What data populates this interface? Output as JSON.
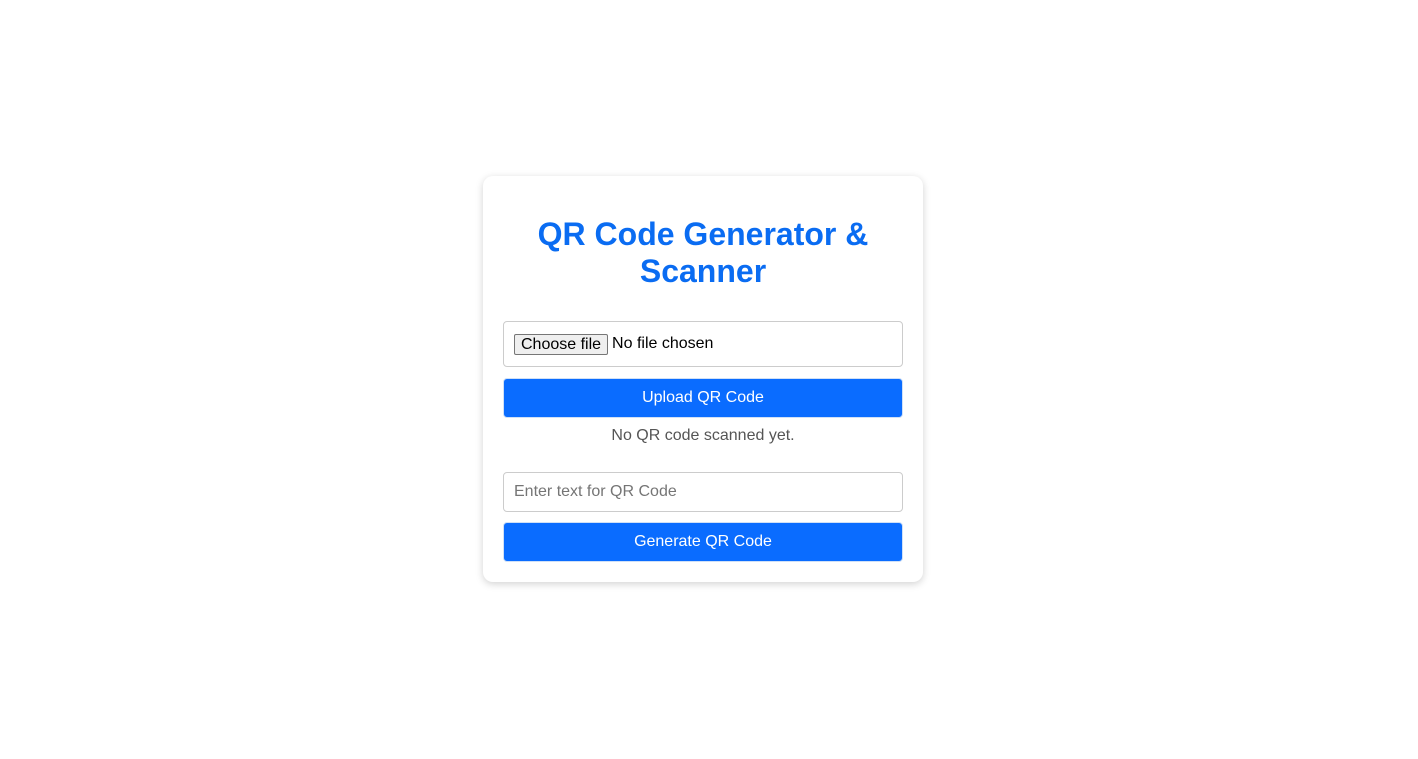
{
  "card": {
    "title": "QR Code Generator & Scanner"
  },
  "upload": {
    "choose_file_label": "Choose file",
    "file_status": "No file chosen",
    "button_label": "Upload QR Code",
    "scan_status": "No QR code scanned yet."
  },
  "generate": {
    "input_value": "",
    "input_placeholder": "Enter text for QR Code",
    "button_label": "Generate QR Code"
  },
  "colors": {
    "accent": "#0a6cff",
    "title": "#0a6cf2",
    "muted_text": "#555555"
  }
}
